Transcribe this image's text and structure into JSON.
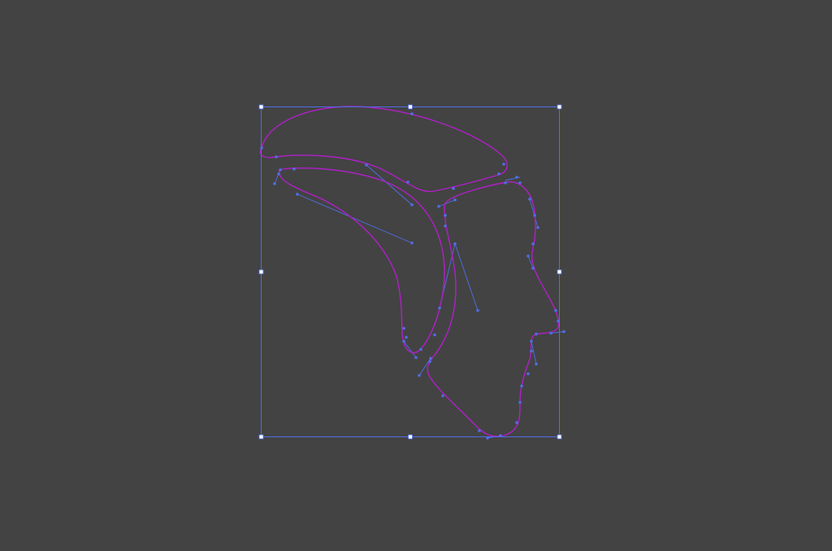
{
  "editor": {
    "canvas_background": "#434343",
    "selection_color": "#4f6ee8",
    "path_color": "#b020c8",
    "handle_fill": "#ffffff"
  },
  "selection": {
    "type": "bounding-box",
    "handles": [
      "top-left",
      "top-center",
      "top-right",
      "middle-left",
      "middle-right",
      "bottom-left",
      "bottom-center",
      "bottom-right"
    ]
  },
  "artwork": {
    "paths": [
      "outer-horn-path",
      "inner-horn-path",
      "profile-face-path"
    ],
    "anchor_icon": "anchor-point-dot",
    "handle_icon": "bezier-handle-line"
  }
}
